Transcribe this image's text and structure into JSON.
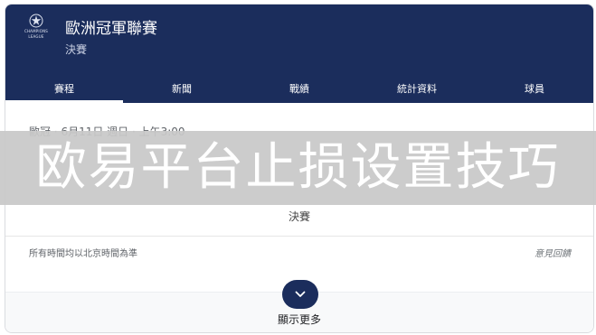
{
  "header": {
    "logo_line1": "CHAMPIONS",
    "logo_line2": "LEAGUE",
    "title": "歐洲冠軍聯賽",
    "subtitle": "決賽"
  },
  "tabs": [
    {
      "label": "賽程",
      "active": true
    },
    {
      "label": "新聞",
      "active": false
    },
    {
      "label": "戰績",
      "active": false
    },
    {
      "label": "統計資料",
      "active": false
    },
    {
      "label": "球員",
      "active": false
    }
  ],
  "match": {
    "info": "歐冠 · 6月11日 週日 · 上午3:00",
    "stage": "決賽"
  },
  "footnote": "所有時間均以北京時間為準",
  "feedback": "意見回饋",
  "show_more": "顯示更多",
  "overlay": "欧易平台止损设置技巧",
  "colors": {
    "header_bg": "#1b2d5c",
    "accent": "#1b2d5c"
  }
}
